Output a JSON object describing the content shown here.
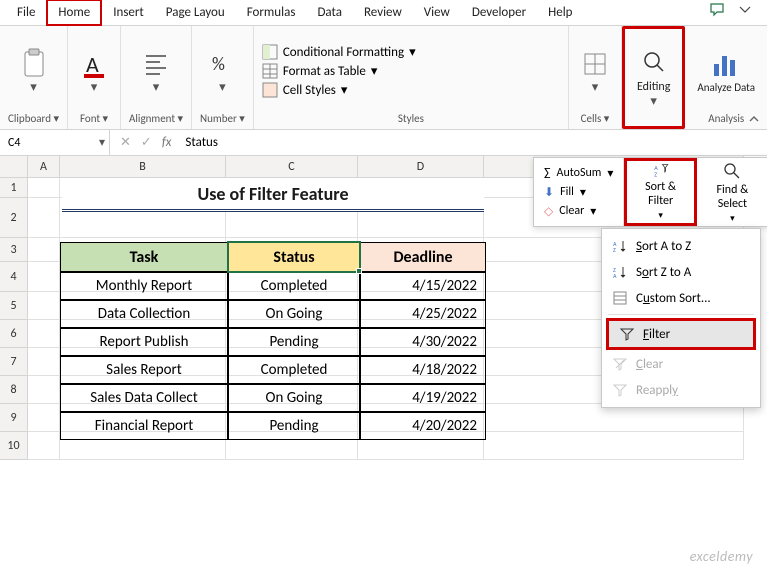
{
  "tabs": [
    "File",
    "Home",
    "Insert",
    "Page Layou",
    "Formulas",
    "Data",
    "Review",
    "View",
    "Developer",
    "Help"
  ],
  "ribbon": {
    "clipboard": "Clipboard",
    "font": "Font",
    "alignment": "Alignment",
    "number": "Number",
    "styles": "Styles",
    "styles_items": {
      "cond_fmt": "Conditional Formatting",
      "fmt_table": "Format as Table",
      "cell_styles": "Cell Styles"
    },
    "cells": "Cells",
    "editing": "Editing",
    "analyze": "Analyze Data",
    "analysis": "Analysis"
  },
  "editing_dropdown": {
    "autosum": "AutoSum",
    "fill": "Fill",
    "clear": "Clear",
    "sort_filter": "Sort & Filter",
    "find_select": "Find & Select"
  },
  "context": {
    "sort_az": "Sort A to Z",
    "sort_za": "Sort Z to A",
    "custom": "Custom Sort...",
    "filter": "Filter",
    "clear": "Clear",
    "reapply": "Reapply"
  },
  "namebox": "C4",
  "formula": "Status",
  "title": "Use of Filter Feature",
  "headers": {
    "task": "Task",
    "status": "Status",
    "deadline": "Deadline"
  },
  "rows": [
    {
      "task": "Monthly Report",
      "status": "Completed",
      "deadline": "4/15/2022"
    },
    {
      "task": "Data Collection",
      "status": "On Going",
      "deadline": "4/25/2022"
    },
    {
      "task": "Report Publish",
      "status": "Pending",
      "deadline": "4/30/2022"
    },
    {
      "task": "Sales Report",
      "status": "Completed",
      "deadline": "4/18/2022"
    },
    {
      "task": "Sales Data Collect",
      "status": "On Going",
      "deadline": "4/19/2022"
    },
    {
      "task": "Financial Report",
      "status": "Pending",
      "deadline": "4/20/2022"
    }
  ],
  "cols": [
    "A",
    "B",
    "C",
    "D"
  ],
  "rownums": [
    "1",
    "2",
    "3",
    "4",
    "5",
    "6",
    "7",
    "8",
    "9",
    "10"
  ],
  "watermark": "exceldemy"
}
